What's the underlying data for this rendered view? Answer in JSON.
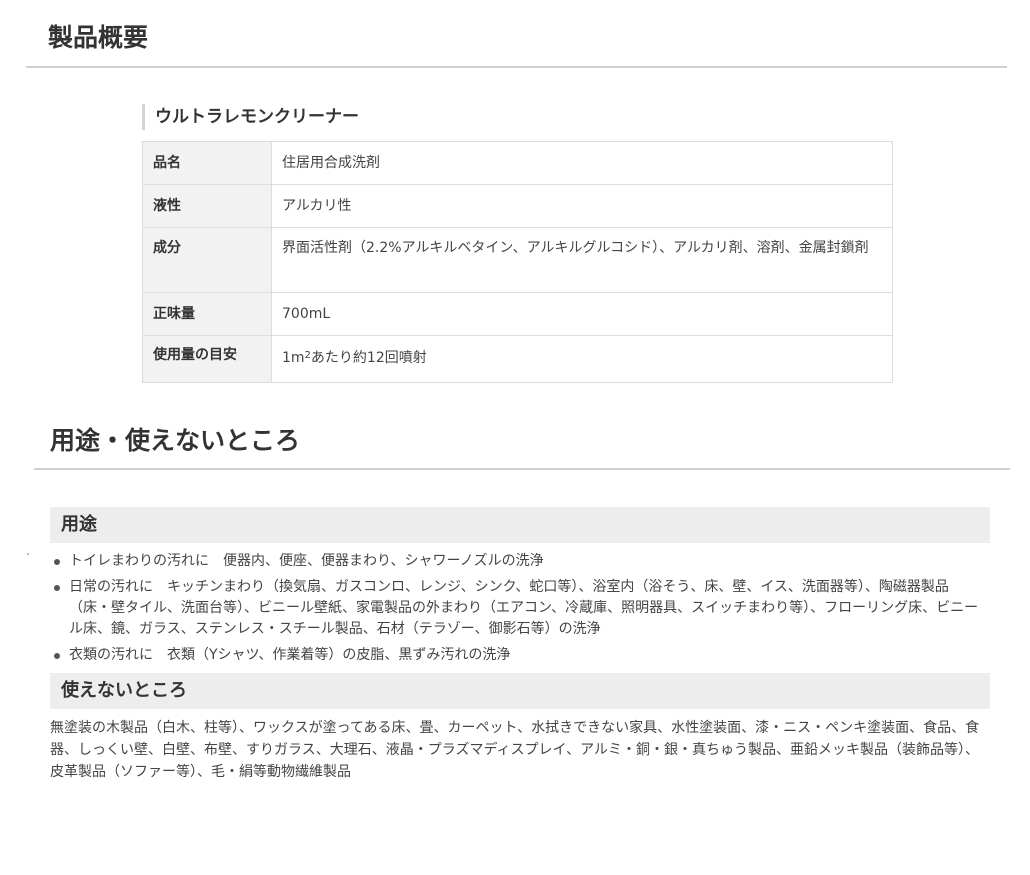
{
  "overview": {
    "heading": "製品概要",
    "product_name": "ウルトラレモンクリーナー",
    "rows": [
      {
        "label": "品名",
        "value": "住居用合成洗剤"
      },
      {
        "label": "液性",
        "value": "アルカリ性"
      },
      {
        "label": "成分",
        "value": "界面活性剤（2.2%アルキルベタイン、アルキルグルコシド）、アルカリ剤、溶剤、金属封鎖剤"
      },
      {
        "label": "正味量",
        "value": "700mL"
      },
      {
        "label": "使用量の目安",
        "value_pre": "1m",
        "value_sup": "2",
        "value_post": "あたり約12回噴射"
      }
    ]
  },
  "usage_section": {
    "heading": "用途・使えないところ",
    "usage": {
      "title": "用途",
      "items": [
        {
          "category": "トイレまわりの汚れに",
          "text": "便器内、便座、便器まわり、シャワーノズルの洗浄"
        },
        {
          "category": "日常の汚れに",
          "text": "キッチンまわり（換気扇、ガスコンロ、レンジ、シンク、蛇口等）、浴室内（浴そう、床、壁、イス、洗面器等）、陶磁器製品（床・壁タイル、洗面台等）、ビニール壁紙、家電製品の外まわり（エアコン、冷蔵庫、照明器具、スイッチまわり等）、フローリング床、ビニール床、鏡、ガラス、ステンレス・スチール製品、石材（テラゾー、御影石等）の洗浄"
        },
        {
          "category": "衣類の汚れに",
          "text": "衣類（Yシャツ、作業着等）の皮脂、黒ずみ汚れの洗浄"
        }
      ]
    },
    "not_usable": {
      "title": "使えないところ",
      "text": "無塗装の木製品（白木、柱等）、ワックスが塗ってある床、畳、カーペット、水拭きできない家具、水性塗装面、漆・ニス・ペンキ塗装面、食品、食器、しっくい壁、白壁、布壁、すりガラス、大理石、液晶・プラズマディスプレイ、アルミ・銅・銀・真ちゅう製品、亜鉛メッキ製品（装飾品等）、皮革製品（ソファー等）、毛・絹等動物繊維製品"
    }
  }
}
